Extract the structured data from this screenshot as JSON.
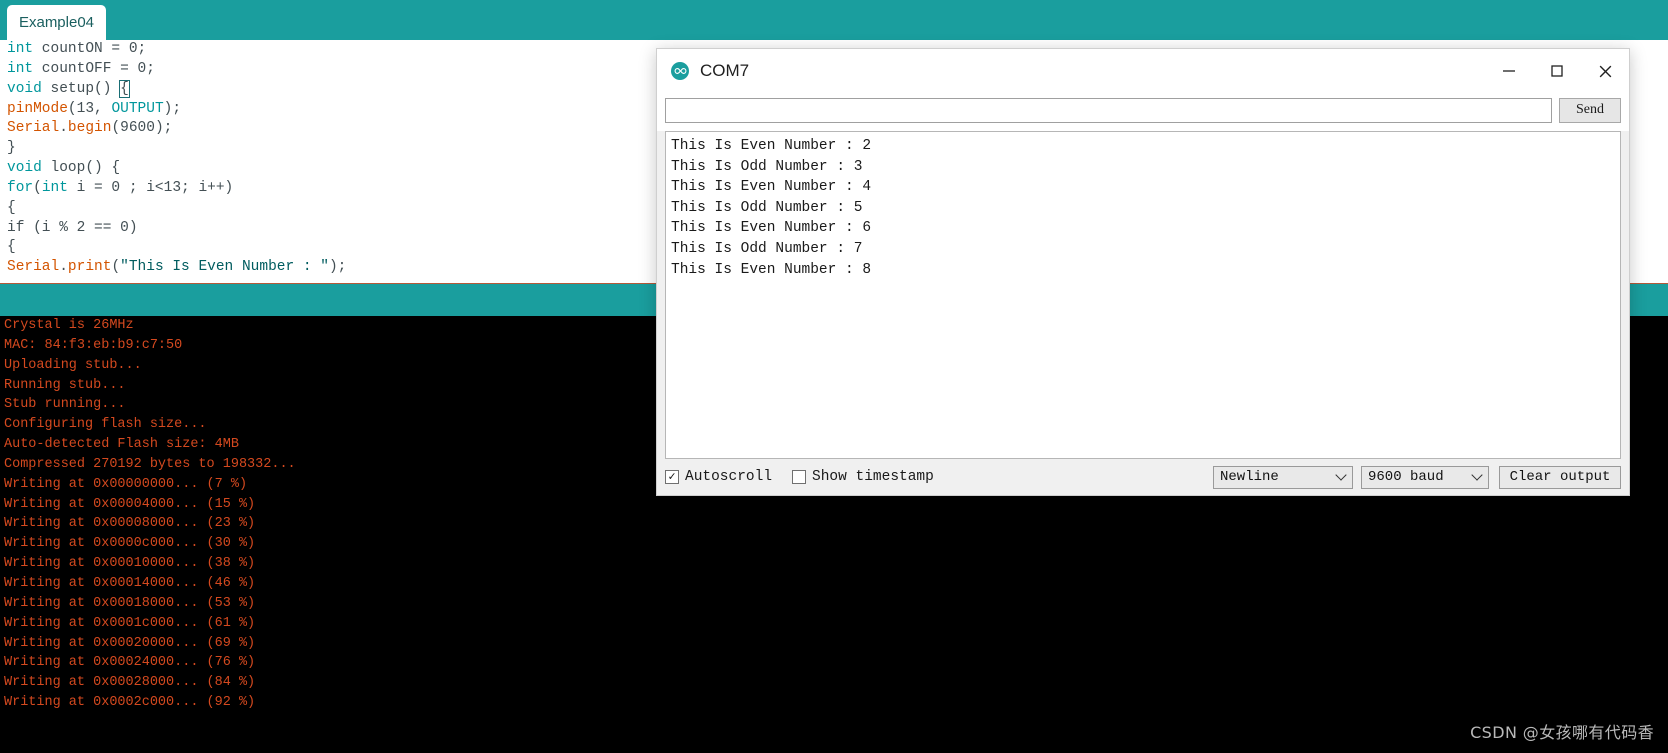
{
  "ide": {
    "tab_label": "Example04",
    "accent_color": "#1a9e9e",
    "editor": {
      "lines": [
        [
          {
            "t": "int",
            "c": "kw"
          },
          {
            "t": " countON = 0;",
            "c": "plain"
          }
        ],
        [
          {
            "t": "int",
            "c": "kw"
          },
          {
            "t": " countOFF = 0;",
            "c": "plain"
          }
        ],
        [
          {
            "t": "void",
            "c": "kw"
          },
          {
            "t": " setup",
            "c": "plain"
          },
          {
            "t": "() ",
            "c": "plain"
          },
          {
            "t": "{",
            "c": "brace"
          }
        ],
        [
          {
            "t": "pinMode",
            "c": "fn"
          },
          {
            "t": "(13, ",
            "c": "plain"
          },
          {
            "t": "OUTPUT",
            "c": "const"
          },
          {
            "t": ");",
            "c": "plain"
          }
        ],
        [
          {
            "t": "Serial",
            "c": "fn"
          },
          {
            "t": ".",
            "c": "plain"
          },
          {
            "t": "begin",
            "c": "fn"
          },
          {
            "t": "(9600);",
            "c": "plain"
          }
        ],
        [
          {
            "t": "}",
            "c": "plain"
          }
        ],
        [
          {
            "t": "void",
            "c": "kw"
          },
          {
            "t": " loop() {",
            "c": "plain"
          }
        ],
        [
          {
            "t": "for",
            "c": "kw"
          },
          {
            "t": "(",
            "c": "plain"
          },
          {
            "t": "int",
            "c": "kw"
          },
          {
            "t": " i = 0 ; i<13; i++)",
            "c": "plain"
          }
        ],
        [
          {
            "t": "{",
            "c": "plain"
          }
        ],
        [
          {
            "t": "if (i % 2 == 0)",
            "c": "plain"
          }
        ],
        [
          {
            "t": "{",
            "c": "plain"
          }
        ],
        [
          {
            "t": "Serial",
            "c": "fn"
          },
          {
            "t": ".",
            "c": "plain"
          },
          {
            "t": "print",
            "c": "fn"
          },
          {
            "t": "(",
            "c": "plain"
          },
          {
            "t": "\"This Is Even Number : \"",
            "c": "str"
          },
          {
            "t": ");",
            "c": "plain"
          }
        ]
      ]
    },
    "console": {
      "lines": [
        "Crystal is 26MHz",
        "MAC: 84:f3:eb:b9:c7:50",
        "Uploading stub...",
        "Running stub...",
        "Stub running...",
        "Configuring flash size...",
        "Auto-detected Flash size: 4MB",
        "Compressed 270192 bytes to 198332...",
        "Writing at 0x00000000... (7 %)",
        "Writing at 0x00004000... (15 %)",
        "Writing at 0x00008000... (23 %)",
        "Writing at 0x0000c000... (30 %)",
        "Writing at 0x00010000... (38 %)",
        "Writing at 0x00014000... (46 %)",
        "Writing at 0x00018000... (53 %)",
        "Writing at 0x0001c000... (61 %)",
        "Writing at 0x00020000... (69 %)",
        "Writing at 0x00024000... (76 %)",
        "Writing at 0x00028000... (84 %)",
        "Writing at 0x0002c000... (92 %)"
      ],
      "text_color": "#d4491f",
      "background": "#000000"
    }
  },
  "serial_monitor": {
    "title": "COM7",
    "logo_icon": "arduino-infinity-icon",
    "window_controls": {
      "minimize": "—",
      "maximize": "□",
      "close": "✕"
    },
    "send": {
      "input_value": "",
      "input_placeholder": "",
      "button_label": "Send"
    },
    "output_lines": [
      "This Is Even Number : 2",
      "This Is Odd Number : 3",
      "This Is Even Number : 4",
      "This Is Odd Number : 5",
      "This Is Even Number : 6",
      "This Is Odd Number : 7",
      "This Is Even Number : 8"
    ],
    "footer": {
      "autoscroll_label": "Autoscroll",
      "autoscroll_checked": true,
      "autoscroll_check_glyph": "✓",
      "timestamp_label": "Show timestamp",
      "timestamp_checked": false,
      "timestamp_check_glyph": "",
      "line_ending_selected": "Newline",
      "baud_selected": "9600 baud",
      "clear_button_label": "Clear output"
    }
  },
  "watermark": {
    "text": "CSDN @女孩哪有代码香"
  }
}
